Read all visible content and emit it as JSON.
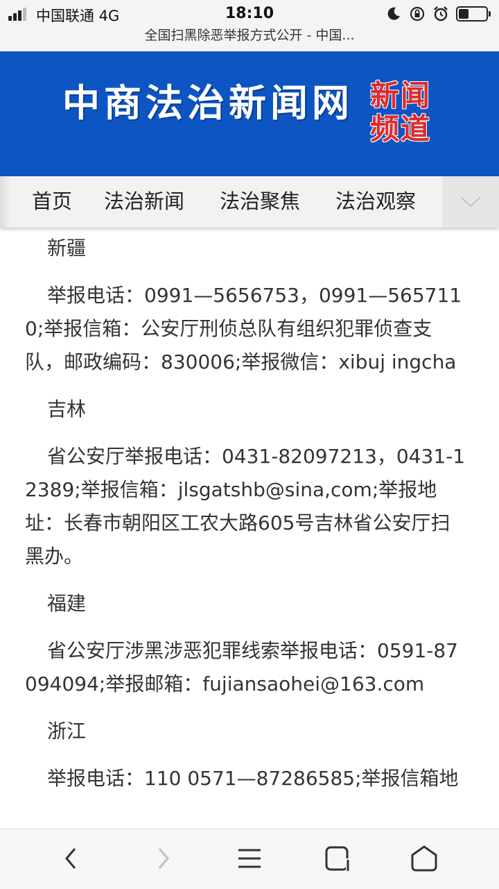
{
  "status_bar": {
    "carrier": "中国联通  4G",
    "time": "18:10",
    "icons": [
      "moon-icon",
      "rotation-lock-icon",
      "alarm-icon",
      "battery-icon"
    ]
  },
  "page_title": "全国扫黑除恶举报方式公开 - 中国...",
  "banner": {
    "logo_text": "中商法治新闻网",
    "stamp_line1": "新闻",
    "stamp_line2": "频道",
    "bg_color": "#0d55c2"
  },
  "nav": {
    "items": [
      "首页",
      "法治新闻",
      "法治聚焦",
      "法治观察"
    ],
    "more_icon": "chevron-down-icon"
  },
  "article": {
    "blocks": [
      {
        "region": "新疆",
        "text": "举报电话：0991—5656753，0991—5657110;举报信箱：公安厅刑侦总队有组织犯罪侦查支队，邮政编码：830006;举报微信：xibuj ingcha"
      },
      {
        "region": "吉林",
        "text": "省公安厅举报电话：0431-82097213，0431-12389;举报信箱：jlsgatshb@sina,com;举报地址：长春市朝阳区工农大路605号吉林省公安厅扫黑办。"
      },
      {
        "region": "福建",
        "text": "省公安厅涉黑涉恶犯罪线索举报电话：0591-87094094;举报邮箱：fujiansaohei@163.com"
      },
      {
        "region": "浙江",
        "text": "举报电话：110 0571—87286585;举报信箱地"
      }
    ]
  },
  "toolbar": {
    "icons": [
      "back-icon",
      "forward-icon",
      "menu-icon",
      "tabs-icon",
      "home-icon"
    ]
  }
}
